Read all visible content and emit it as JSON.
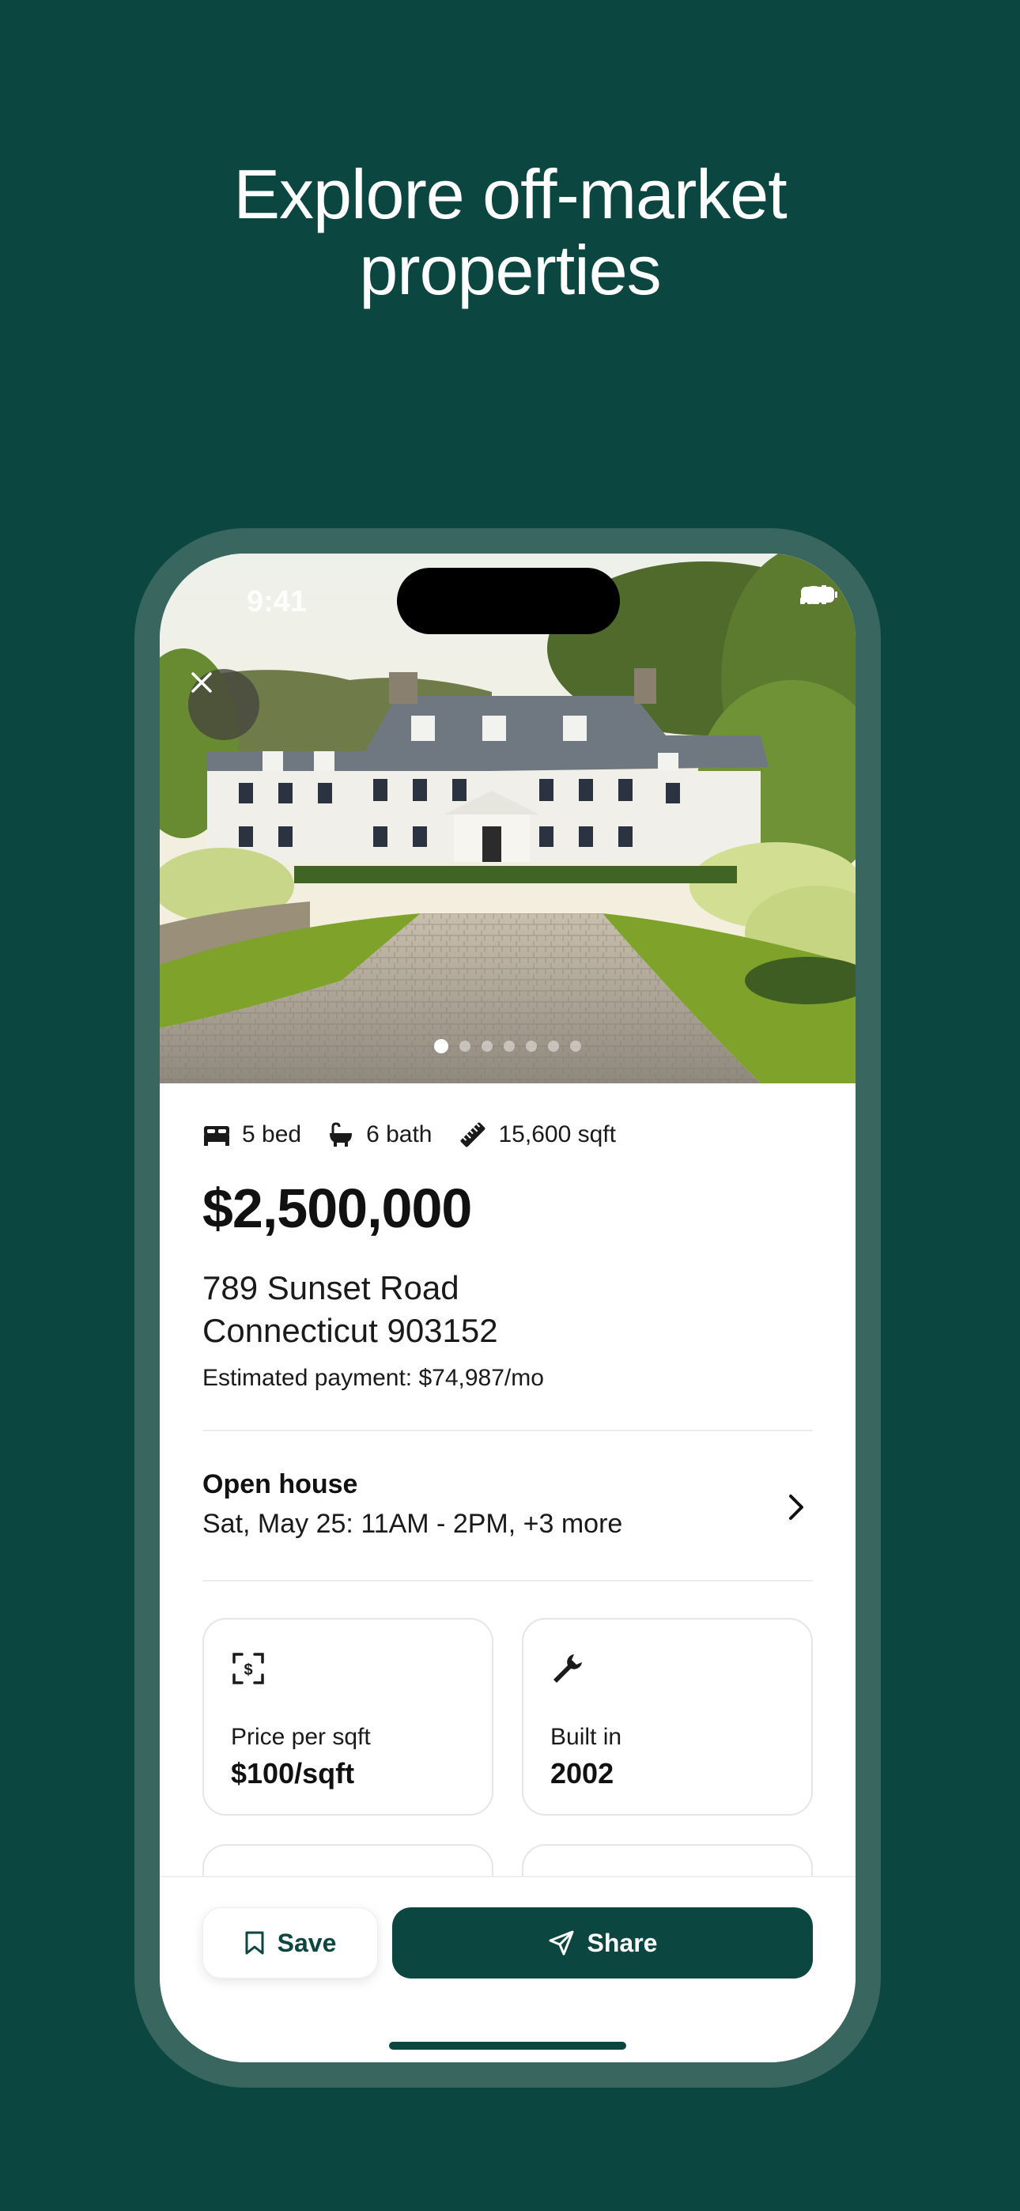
{
  "headline": {
    "line1": "Explore off-market",
    "line2": "properties"
  },
  "status_bar": {
    "time": "9:41"
  },
  "gallery": {
    "photo_count": 7,
    "active_index": 0
  },
  "listing": {
    "specs": [
      {
        "icon": "bed-icon",
        "label": "5 bed"
      },
      {
        "icon": "bathtub-icon",
        "label": "6 bath"
      },
      {
        "icon": "ruler-icon",
        "label": "15,600 sqft"
      }
    ],
    "price": "$2,500,000",
    "address_line1": "789 Sunset Road",
    "address_line2": "Connecticut 903152",
    "estimated_payment": "Estimated payment: $74,987/mo"
  },
  "open_house": {
    "title": "Open house",
    "schedule": "Sat, May 25: 11AM - 2PM, +3 more"
  },
  "cards": [
    {
      "icon": "dollar-scan-icon",
      "label": "Price per sqft",
      "value": "$100/sqft"
    },
    {
      "icon": "wrench-icon",
      "label": "Built in",
      "value": "2002"
    }
  ],
  "actions": {
    "save_label": "Save",
    "share_label": "Share"
  },
  "colors": {
    "brand": "#0b4641",
    "frame": "#39665f",
    "background": "#0b4641"
  }
}
